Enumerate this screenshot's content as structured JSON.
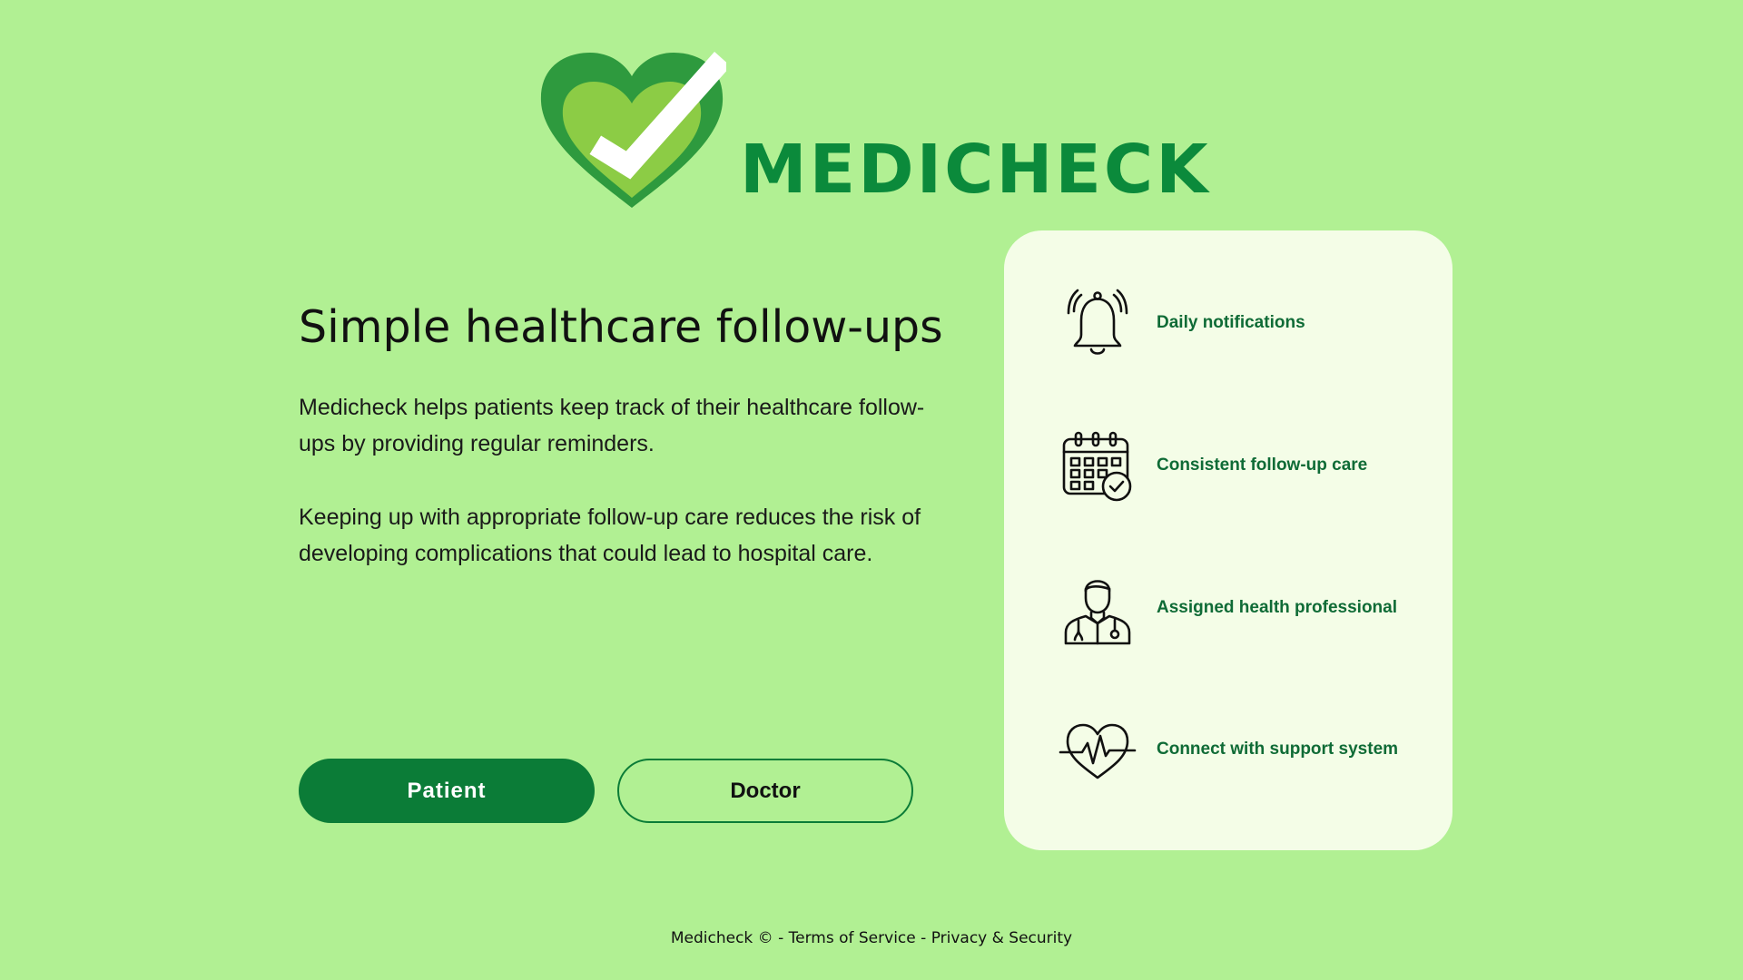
{
  "brand": {
    "name": "MEDICHECK",
    "colors": {
      "primary": "#0b7c37",
      "logo_text": "#0b8a3b",
      "background": "#b1f093",
      "card": "#f4fde7"
    }
  },
  "hero": {
    "title": "Simple healthcare follow-ups",
    "paragraph_1": "Medicheck helps patients keep track of their healthcare follow-ups by providing regular reminders.",
    "paragraph_2": "Keeping up with appropriate follow-up care reduces the risk of developing complications that could lead to hospital care."
  },
  "actions": {
    "patient_label": "Patient",
    "doctor_label": "Doctor"
  },
  "features": [
    {
      "icon": "bell-icon",
      "label": "Daily notifications"
    },
    {
      "icon": "calendar-check-icon",
      "label": "Consistent follow-up care"
    },
    {
      "icon": "doctor-icon",
      "label": "Assigned health professional"
    },
    {
      "icon": "heart-pulse-icon",
      "label": "Connect with support system"
    }
  ],
  "footer": {
    "brand": "Medicheck ©",
    "separator": " - ",
    "terms": "Terms of Service",
    "privacy": "Privacy & Security"
  }
}
